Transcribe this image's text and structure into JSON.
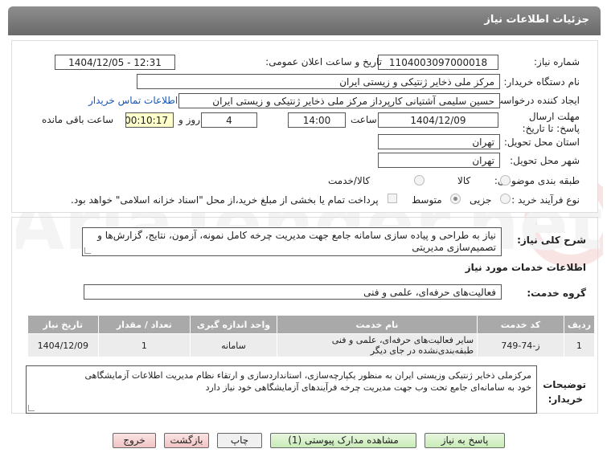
{
  "header": {
    "title": "جزئیات اطلاعات نیاز"
  },
  "fields": {
    "need_number_label": "شماره نیاز:",
    "need_number": "1104003097000018",
    "announce_label": "تاریخ و ساعت اعلان عمومی:",
    "announce_value": "1404/12/05 - 12:31",
    "buyer_org_label": "نام دستگاه خریدار:",
    "buyer_org": "مرکز ملی ذخایر ژنتیکی و زیستی ایران",
    "creator_label": "ایجاد کننده درخواست:",
    "creator": "حسین  سلیمی آشتیانی  کارپرداز مرکز ملی ذخایر ژنتیکی و زیستی ایران",
    "contact_link": "اطلاعات تماس خریدار",
    "deadline_label": "مهلت ارسال پاسخ: تا تاریخ:",
    "deadline_date": "1404/12/09",
    "time_label": "ساعت",
    "deadline_time": "14:00",
    "days_count": "4",
    "days_label": "روز و",
    "remaining_time": "00:10:17",
    "remaining_label": "ساعت باقی مانده",
    "province_label": "استان محل تحویل:",
    "province": "تهران",
    "city_label": "شهر محل تحویل:",
    "city": "تهران",
    "category_label": "طبقه بندی موضوعی:",
    "category_options": [
      "کالا",
      "کالا/خدمت"
    ],
    "purchase_type_label": "نوع فرآیند خرید :",
    "purchase_options": [
      "جزیی",
      "متوسط"
    ],
    "payment_note": "پرداخت تمام یا بخشی از مبلغ خرید،از محل \"اسناد خزانه اسلامی\" خواهد بود."
  },
  "summary": {
    "label": "شرح کلی نیاز:",
    "text_line1": "نیاز به طراحی و پیاده سازی سامانه جامع جهت مدیریت چرخه کامل نمونه، آزمون، نتایج، گزارش‌ها و",
    "text_line2": "تصمیم‌سازی مدیریتی"
  },
  "services": {
    "heading": "اطلاعات خدمات مورد نیاز",
    "group_label": "گروه خدمت:",
    "group_value": "فعالیت‌های حرفه‌ای، علمی و فنی"
  },
  "table": {
    "headers": [
      "ردیف",
      "کد خدمت",
      "نام خدمت",
      "واحد اندازه گیری",
      "تعداد / مقدار",
      "تاریخ نیاز"
    ],
    "rows": [
      [
        "1",
        "ز-74-749",
        "سایر فعالیت‌های حرفه‌ای، علمی و فنی طبقه‌بندی‌نشده در جای دیگر",
        "سامانه",
        "1",
        "1404/12/09"
      ]
    ]
  },
  "buyer_notes": {
    "label_line1": "توضیحات",
    "label_line2": "خریدار:",
    "line1": "مرکزملی ذخایر ژنتیکی وزیستی ایران به منظور یکپارچه‌سازی، استانداردسازی و ارتقاء نظام مدیریت اطلاعات آزمایشگاهی",
    "line2": "خود به سامانه‌ای جامع تحت وب جهت مدیریت چرخه فرآیندهای آزمایشگاهی خود نیاز دارد"
  },
  "buttons": {
    "reply": "پاسخ به نیاز",
    "view_docs": "مشاهده مدارک پیوستی (1)",
    "print": "چاپ",
    "back": "بازگشت",
    "exit": "خروج"
  },
  "watermark": "AriaTender.net",
  "colors": {
    "header": "#7a7a7a",
    "table_header": "#a9a9a9",
    "link": "#1a56b8",
    "reply_button": "#c8ecb6",
    "exit_button": "#f0c4c4"
  }
}
